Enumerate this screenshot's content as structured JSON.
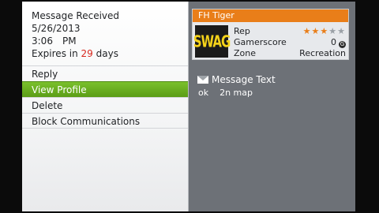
{
  "message": {
    "status": "Message Received",
    "date": "5/26/2013",
    "time": "3:06",
    "ampm": "PM",
    "expires_prefix": "Expires in",
    "expires_days": "29",
    "expires_suffix": "days"
  },
  "menu": {
    "items": [
      "Reply",
      "View Profile",
      "Delete",
      "Block Communications"
    ],
    "selected": "View Profile"
  },
  "profile": {
    "gamertag": "FH Tiger",
    "gamerpic_text": "SWAG",
    "rep_label": "Rep",
    "rep_stars": {
      "filled": 3,
      "total": 5
    },
    "gamerscore_label": "Gamerscore",
    "gamerscore_value": "0",
    "gamerscore_icon": "G",
    "zone_label": "Zone",
    "zone_value": "Recreation"
  },
  "message_text": {
    "heading": "Message Text",
    "body": "ok    2n map"
  },
  "colors": {
    "accent_orange": "#e97e19",
    "selected_green": "#6aae22",
    "highlight_red": "#d7261c",
    "panel_gray": "#6d7177"
  }
}
